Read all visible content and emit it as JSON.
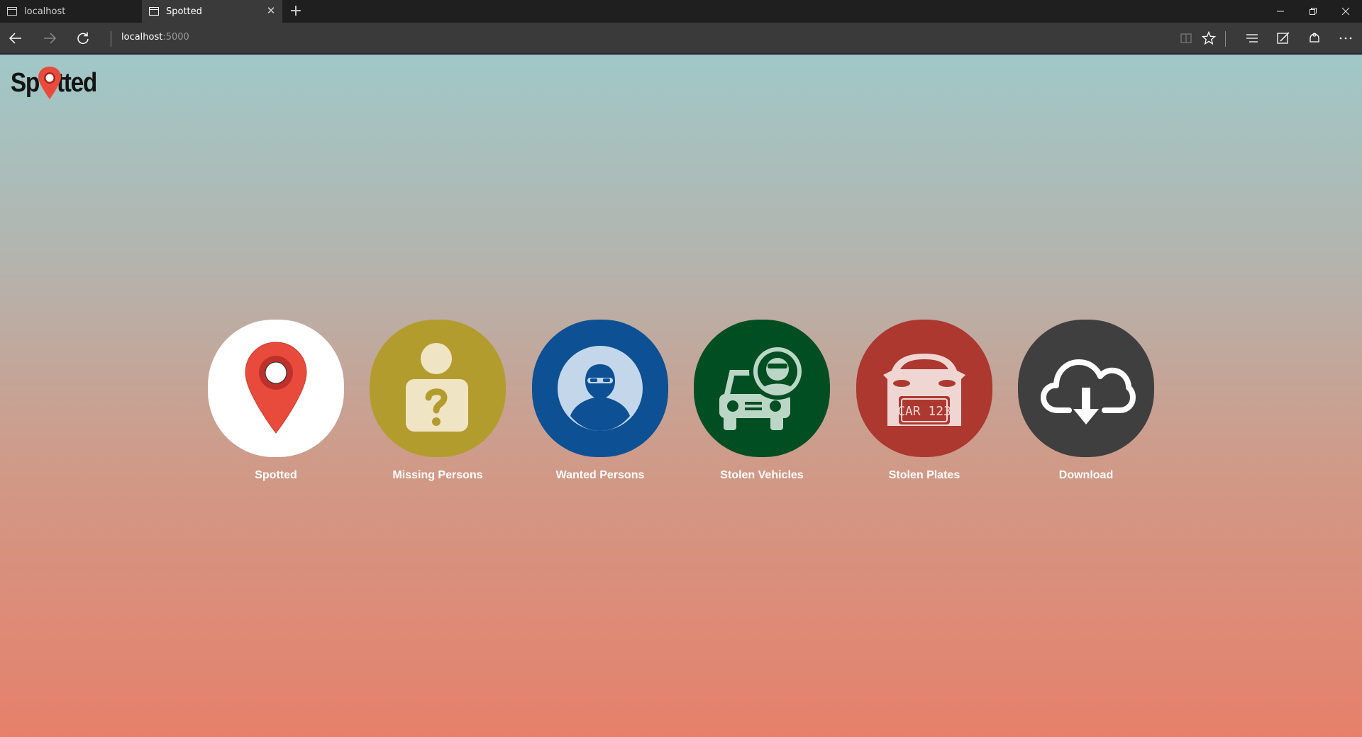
{
  "browser": {
    "tabs": [
      {
        "title": "localhost"
      },
      {
        "title": "Spotted"
      }
    ],
    "url_host": "localhost",
    "url_port": ":5000"
  },
  "app": {
    "logo_text": "Spotted"
  },
  "tiles": [
    {
      "label": "Spotted",
      "color": "#ffffff",
      "icon": "map-pin-icon"
    },
    {
      "label": "Missing Persons",
      "color": "#b39c2e",
      "icon": "missing-person-icon"
    },
    {
      "label": "Wanted Persons",
      "color": "#0d5094",
      "icon": "masked-person-icon"
    },
    {
      "label": "Stolen Vehicles",
      "color": "#014e23",
      "icon": "stolen-vehicle-icon"
    },
    {
      "label": "Stolen Plates",
      "color": "#ac3830",
      "icon": "license-plate-icon",
      "plate_text": "CAR 123"
    },
    {
      "label": "Download",
      "color": "#3f3f3f",
      "icon": "cloud-download-icon"
    }
  ],
  "colors": {
    "pin_red": "#e84b3c",
    "gradient_top": "#a0c8c8",
    "gradient_bottom": "#e6806a"
  }
}
